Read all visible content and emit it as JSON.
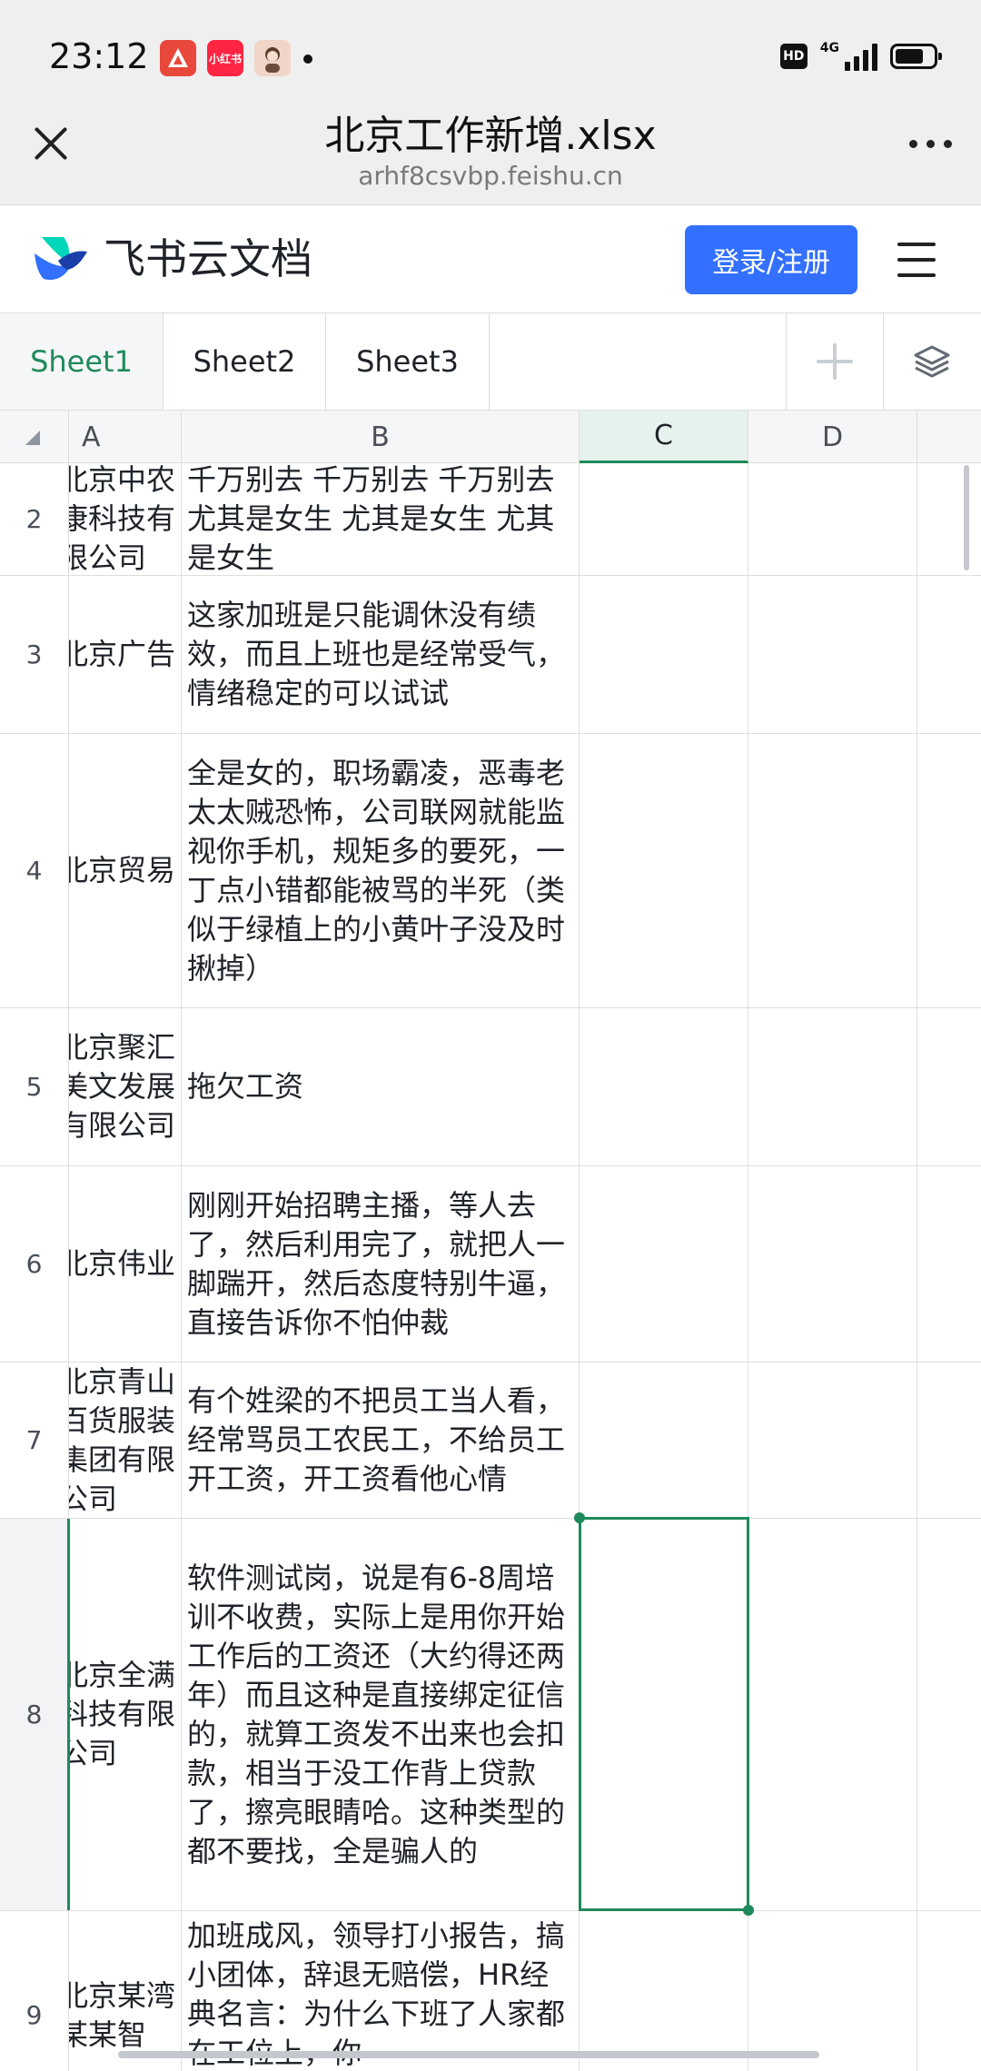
{
  "status_bar": {
    "time": "23:12",
    "apps": [
      {
        "icon": "app-a-icon",
        "label": "",
        "color": "#e8483b"
      },
      {
        "icon": "xiaohongshu-icon",
        "label": "小红书",
        "color": "#ff2442"
      },
      {
        "icon": "avatar-app-icon",
        "label": "",
        "color": "#f0d5c8"
      }
    ],
    "hd": "HD",
    "network": "4G"
  },
  "browser": {
    "title": "北京工作新增.xlsx",
    "url": "arhf8csvbp.feishu.cn"
  },
  "app_header": {
    "brand": "飞书云文档",
    "login_label": "登录/注册",
    "accent_color": "#3370ff"
  },
  "sheet_tabs": [
    {
      "label": "Sheet1",
      "active": true
    },
    {
      "label": "Sheet2",
      "active": false
    },
    {
      "label": "Sheet3",
      "active": false
    }
  ],
  "grid": {
    "columns": [
      "A",
      "B",
      "C",
      "D"
    ],
    "selected_column": "C",
    "selected_row": "8",
    "rows": [
      {
        "num": "2",
        "a": "北京中农康科技有限公司",
        "b": "千万别去 千万别去 千万别去 尤其是女生 尤其是女生 尤其是女生"
      },
      {
        "num": "3",
        "a": "北京广告",
        "b": "这家加班是只能调休没有绩效，而且上班也是经常受气，情绪稳定的可以试试"
      },
      {
        "num": "4",
        "a": "北京贸易",
        "b": "全是女的，职场霸凌，恶毒老太太贼恐怖，公司联网就能监视你手机，规矩多的要死，一丁点小错都能被骂的半死（类似于绿植上的小黄叶子没及时揪掉）"
      },
      {
        "num": "5",
        "a": "北京聚汇美文发展有限公司",
        "b": "拖欠工资"
      },
      {
        "num": "6",
        "a": "北京伟业",
        "b": "刚刚开始招聘主播，等人去了，然后利用完了，就把人一脚踹开，然后态度特别牛逼，直接告诉你不怕仲裁"
      },
      {
        "num": "7",
        "a": "北京青山百货服装集团有限公司",
        "b": "有个姓梁的不把员工当人看，经常骂员工农民工，不给员工开工资，开工资看他心情"
      },
      {
        "num": "8",
        "a": "北京全满科技有限公司",
        "b": "软件测试岗，说是有6-8周培训不收费，实际上是用你开始工作后的工资还（大约得还两年）而且这种是直接绑定征信的，就算工资发不出来也会扣款，相当于没工作背上贷款了，擦亮眼睛哈。这种类型的都不要找，全是骗人的"
      },
      {
        "num": "9",
        "a": "北京某湾某某智",
        "b": "加班成风，领导打小报告，搞小团体，辞退无赔偿，HR经典名言：为什么下班了人家都在工位上，你"
      }
    ]
  }
}
